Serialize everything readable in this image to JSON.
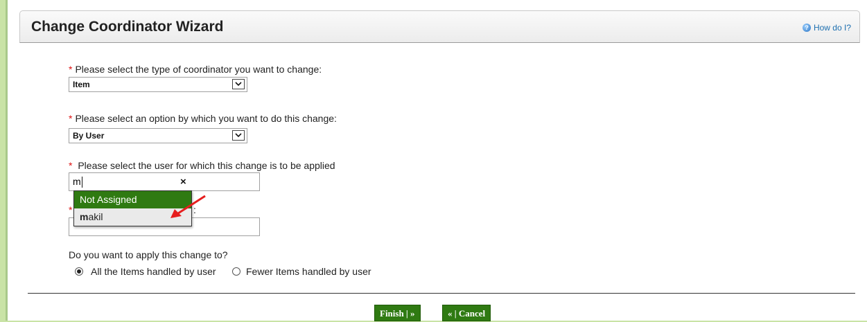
{
  "wizard": {
    "title": "Change Coordinator Wizard",
    "help_link": "How do I?"
  },
  "form": {
    "required_marker": "*",
    "coordinator_type": {
      "label": "Please select the type of coordinator you want to change:",
      "value": "Item"
    },
    "change_option": {
      "label": "Please select an option by which you want to do this change:",
      "value": "By User"
    },
    "user_select": {
      "label": "Please select the user for which this change is to be applied",
      "value": "m",
      "clear": "×"
    },
    "user_dropdown": {
      "options": [
        {
          "label": "Not Assigned",
          "state": "selected"
        },
        {
          "match": "m",
          "rest": "akil",
          "state": "hover"
        }
      ]
    },
    "second_field": {
      "partial_label": ":"
    },
    "apply_scope": {
      "question": "Do you want to apply this change to?",
      "options": [
        {
          "label": "All the Items handled by user",
          "checked": true
        },
        {
          "label": "Fewer Items handled by user",
          "checked": false
        }
      ]
    }
  },
  "buttons": {
    "finish": "Finish | »",
    "cancel": "« | Cancel"
  },
  "colors": {
    "accent_green": "#2f7a12",
    "required_red": "#dd1111",
    "annotation_arrow": "#e61e1e",
    "page_background": "#c9e3a6"
  }
}
